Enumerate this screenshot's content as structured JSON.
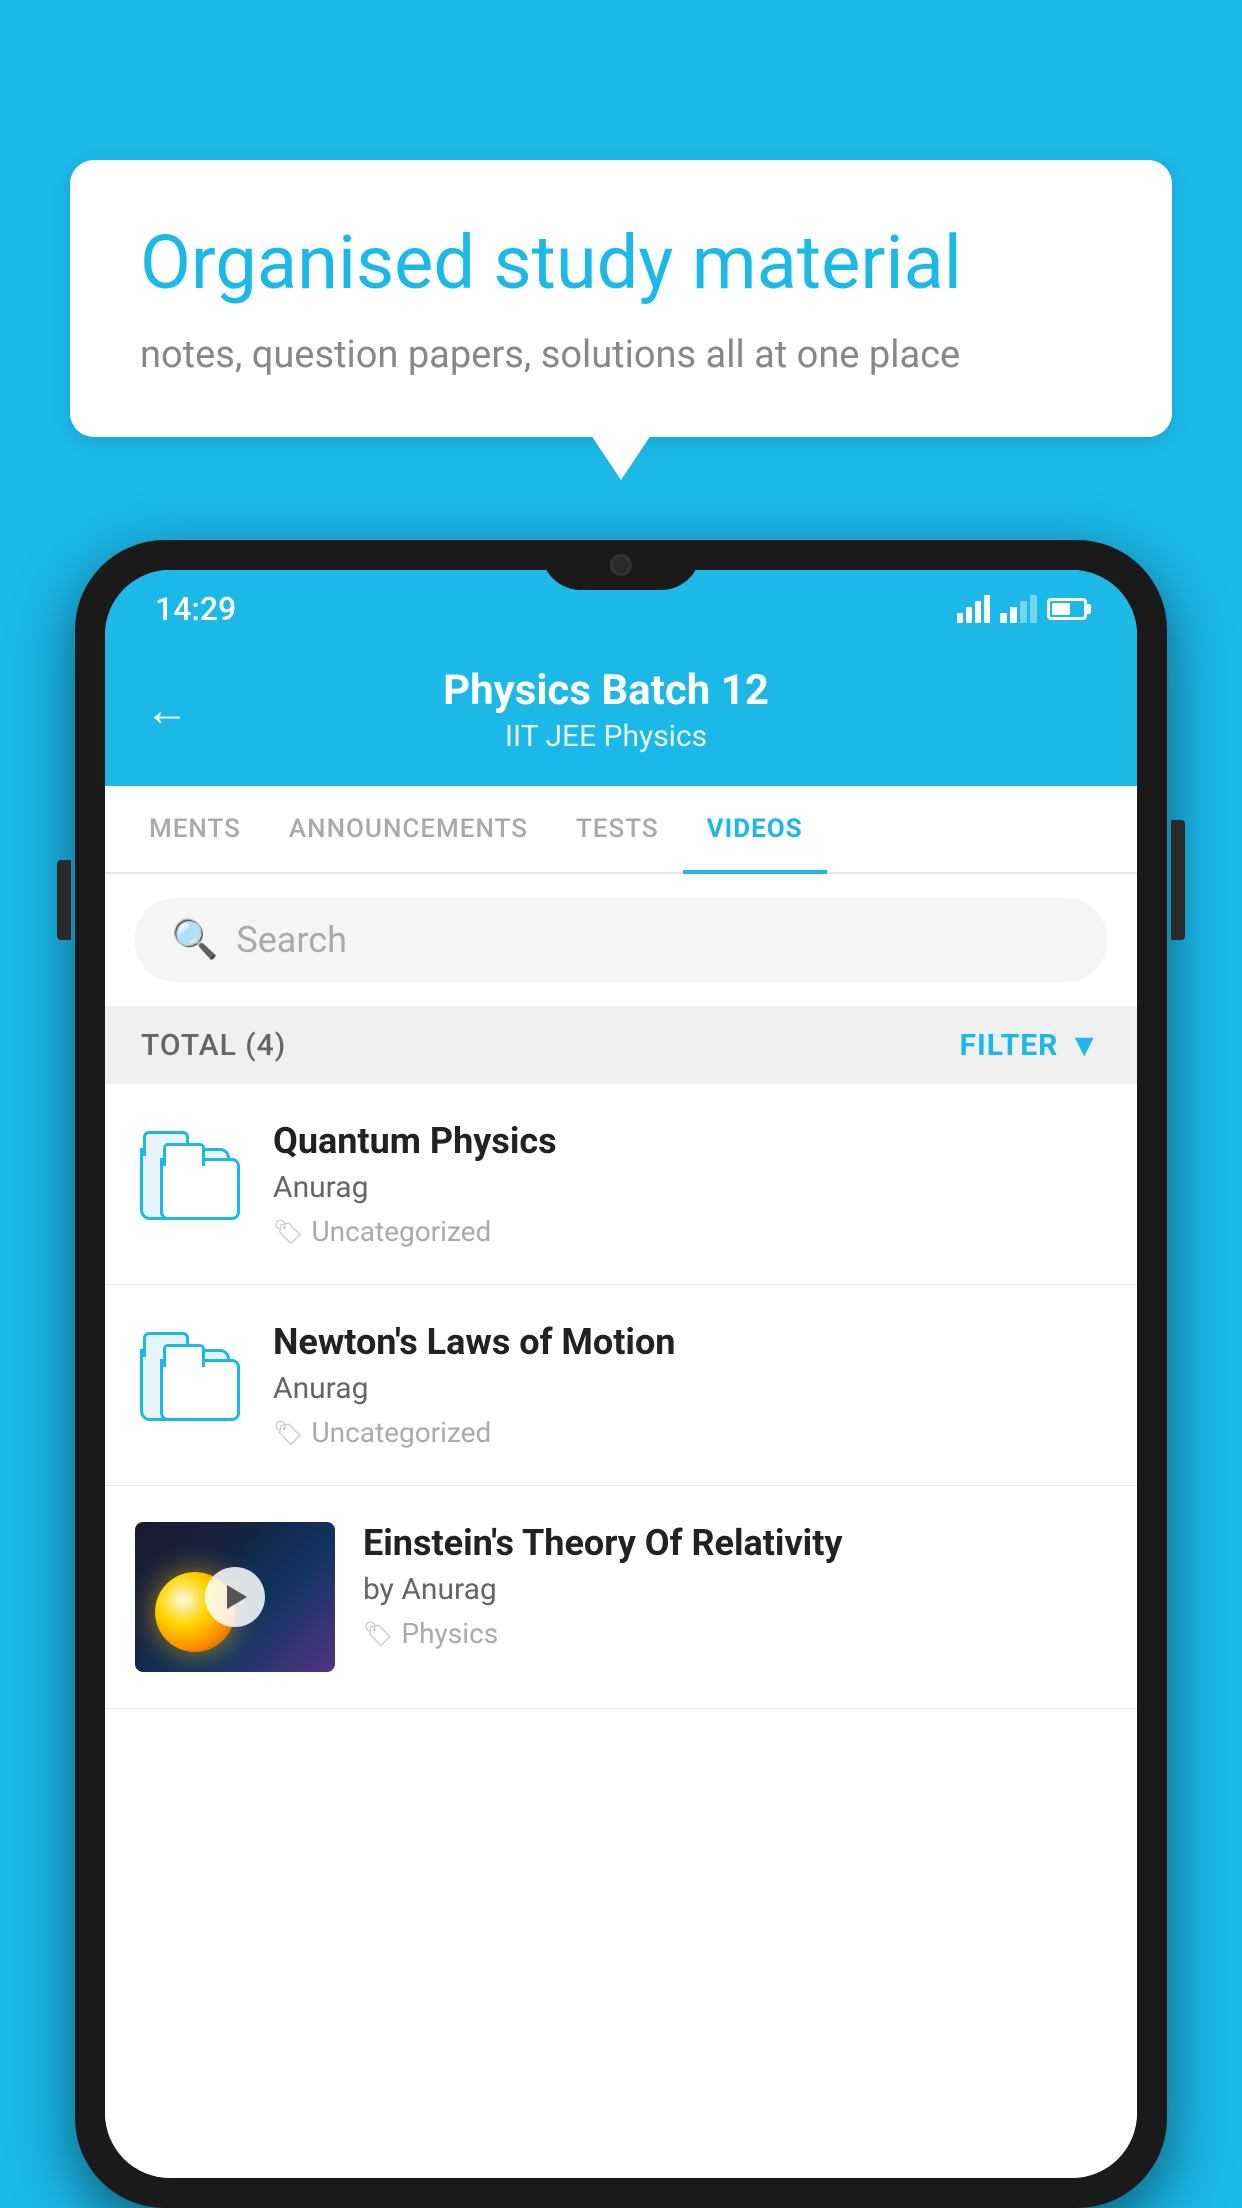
{
  "background_color": "#1BB8E8",
  "speech_bubble": {
    "title": "Organised study material",
    "subtitle": "notes, question papers, solutions all at one place"
  },
  "status_bar": {
    "time": "14:29",
    "wifi": "▲",
    "battery": "60%"
  },
  "app_header": {
    "back_label": "←",
    "title": "Physics Batch 12",
    "subtitle": "IIT JEE    Physics"
  },
  "tabs": [
    {
      "label": "MENTS",
      "active": false
    },
    {
      "label": "ANNOUNCEMENTS",
      "active": false
    },
    {
      "label": "TESTS",
      "active": false
    },
    {
      "label": "VIDEOS",
      "active": true
    }
  ],
  "search": {
    "placeholder": "Search"
  },
  "filter_bar": {
    "total_label": "TOTAL (4)",
    "filter_label": "FILTER"
  },
  "videos": [
    {
      "title": "Quantum Physics",
      "author": "Anurag",
      "tag": "Uncategorized",
      "has_thumb": false
    },
    {
      "title": "Newton's Laws of Motion",
      "author": "Anurag",
      "tag": "Uncategorized",
      "has_thumb": false
    },
    {
      "title": "Einstein's Theory Of Relativity",
      "author": "by Anurag",
      "tag": "Physics",
      "has_thumb": true
    }
  ]
}
